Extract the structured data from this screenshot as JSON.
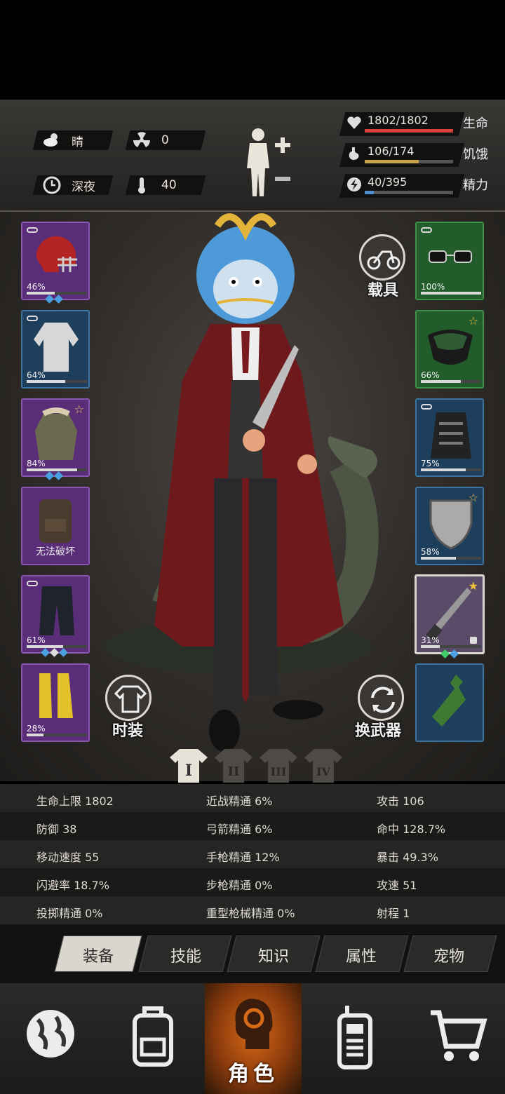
{
  "header": {
    "weather": {
      "icon": "cloud-sun-icon",
      "value": "晴"
    },
    "radiation": {
      "icon": "radiation-icon",
      "value": "0"
    },
    "time": {
      "icon": "clock-icon",
      "value": "深夜"
    },
    "temperature": {
      "icon": "thermometer-icon",
      "value": "40"
    },
    "vitals": [
      {
        "icon": "heart-icon",
        "value": "1802/1802",
        "label": "生命",
        "fraction": 1.0,
        "color": "#d9453a"
      },
      {
        "icon": "stomach-icon",
        "value": "106/174",
        "label": "饥饿",
        "fraction": 0.61,
        "color": "#c9a34a"
      },
      {
        "icon": "lightning-icon",
        "value": "40/395",
        "label": "精力",
        "fraction": 0.1,
        "color": "#4f8fd1"
      }
    ]
  },
  "equipment": {
    "left": [
      {
        "name": "helmet",
        "icon": "football-helmet-icon",
        "durability": "46%",
        "fraction": 0.46
      },
      {
        "name": "shirt",
        "icon": "shirt-icon",
        "durability": "64%",
        "fraction": 0.64
      },
      {
        "name": "jacket",
        "icon": "parka-icon",
        "durability": "84%",
        "fraction": 0.84
      },
      {
        "name": "backpack",
        "icon": "backpack-icon",
        "status": "无法破坏"
      },
      {
        "name": "pants",
        "icon": "pants-icon",
        "durability": "61%",
        "fraction": 0.61
      },
      {
        "name": "boots",
        "icon": "boots-icon",
        "durability": "28%",
        "fraction": 0.28
      }
    ],
    "right": [
      {
        "name": "glasses",
        "icon": "glasses-icon",
        "durability": "100%",
        "fraction": 1.0
      },
      {
        "name": "gas-mask",
        "icon": "mask-icon",
        "durability": "66%",
        "fraction": 0.66
      },
      {
        "name": "vest",
        "icon": "tactical-vest-icon",
        "durability": "75%",
        "fraction": 0.75
      },
      {
        "name": "shield",
        "icon": "shield-icon",
        "durability": "58%",
        "fraction": 0.58
      },
      {
        "name": "machete",
        "icon": "machete-icon",
        "durability": "31%",
        "fraction": 0.31
      },
      {
        "name": "molotov",
        "icon": "bottle-icon"
      }
    ],
    "vehicle_label": "载具",
    "fashion_label": "时装",
    "swap_weapon_label": "换武器",
    "outfit_tabs": [
      "I",
      "II",
      "III",
      "IV"
    ]
  },
  "stats": [
    [
      "生命上限 1802",
      "近战精通 6%",
      "攻击 106"
    ],
    [
      "防御 38",
      "弓箭精通 6%",
      "命中 128.7%"
    ],
    [
      "移动速度 55",
      "手枪精通 12%",
      "暴击 49.3%"
    ],
    [
      "闪避率 18.7%",
      "步枪精通 0%",
      "攻速 51"
    ],
    [
      "投掷精通 0%",
      "重型枪械精通 0%",
      "射程 1"
    ]
  ],
  "tabs": [
    "装备",
    "技能",
    "知识",
    "属性",
    "宠物"
  ],
  "nav": [
    {
      "icon": "globe-icon",
      "label": ""
    },
    {
      "icon": "backpack-icon",
      "label": ""
    },
    {
      "icon": "head-gear-icon",
      "label": "角色"
    },
    {
      "icon": "walkie-talkie-icon",
      "label": ""
    },
    {
      "icon": "cart-icon",
      "label": ""
    }
  ]
}
